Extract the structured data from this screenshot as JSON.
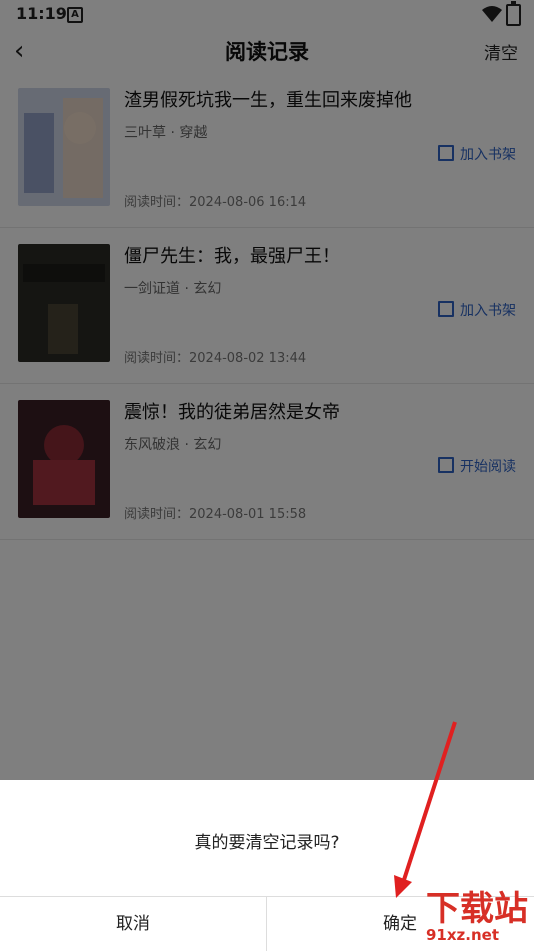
{
  "status": {
    "time": "11:19",
    "badge": "A"
  },
  "header": {
    "back": "‹",
    "title": "阅读记录",
    "clear": "清空"
  },
  "records": [
    {
      "title": "渣男假死坑我一生，重生回来废掉他",
      "meta": "三叶草 · 穿越",
      "action": "加入书架",
      "time": "阅读时间：2024-08-06 16:14"
    },
    {
      "title": "僵尸先生：我，最强尸王！",
      "meta": "一剑证道 · 玄幻",
      "action": "加入书架",
      "time": "阅读时间：2024-08-02 13:44"
    },
    {
      "title": "震惊！我的徒弟居然是女帝",
      "meta": "东风破浪 · 玄幻",
      "action": "开始阅读",
      "time": "阅读时间：2024-08-01 15:58"
    }
  ],
  "dialog": {
    "message": "真的要清空记录吗?",
    "cancel": "取消",
    "confirm": "确定"
  },
  "watermark": {
    "logo": "下载站",
    "url": "91xz.net"
  }
}
